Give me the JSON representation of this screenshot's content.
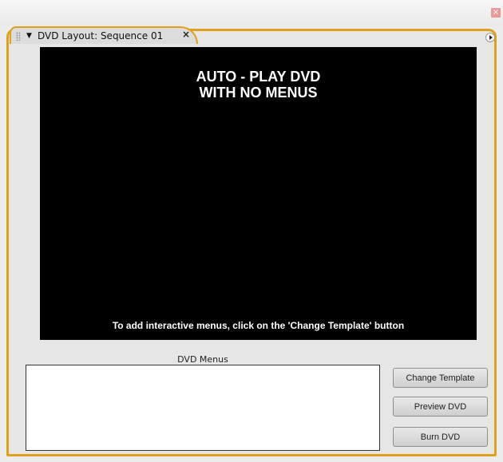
{
  "window": {
    "close_glyph": "×"
  },
  "tab": {
    "title": "DVD Layout: Sequence 01",
    "collapse_glyph": "▼",
    "close_glyph": "×"
  },
  "preview": {
    "heading_line1": "AUTO - PLAY DVD",
    "heading_line2": "WITH NO MENUS",
    "hint": "To add interactive menus, click on the 'Change Template' button"
  },
  "menus": {
    "label": "DVD Menus",
    "items": []
  },
  "buttons": {
    "change_template": "Change Template",
    "preview_dvd": "Preview DVD",
    "burn_dvd": "Burn DVD"
  },
  "colors": {
    "panel_accent": "#e1a019",
    "preview_background": "#000000"
  }
}
